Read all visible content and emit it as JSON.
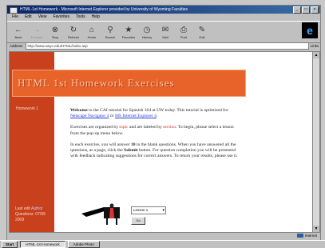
{
  "window": {
    "title": "HTML-1st Homework - Microsoft Internet Explorer provided by University of Wyoming Faculties",
    "min_label": "_",
    "max_label": "□",
    "close_label": "×"
  },
  "menu": [
    "File",
    "Edit",
    "View",
    "Favorites",
    "Tools",
    "Help"
  ],
  "toolbar": [
    {
      "label": "Back",
      "icon": "←",
      "icon_name": "back-arrow-icon",
      "enabled": true
    },
    {
      "label": "Forward",
      "icon": "→",
      "icon_name": "forward-arrow-icon",
      "enabled": false
    },
    {
      "label": "Stop",
      "icon": "⊗",
      "icon_name": "stop-icon",
      "enabled": true
    },
    {
      "label": "Refresh",
      "icon": "↻",
      "icon_name": "refresh-icon",
      "enabled": true
    },
    {
      "label": "Home",
      "icon": "⌂",
      "icon_name": "home-icon",
      "enabled": true
    },
    {
      "label": "Search",
      "icon": "⚲",
      "icon_name": "search-icon",
      "enabled": true
    },
    {
      "label": "Favorites",
      "icon": "★",
      "icon_name": "favorites-icon",
      "enabled": true
    },
    {
      "label": "History",
      "icon": "◷",
      "icon_name": "history-icon",
      "enabled": true
    },
    {
      "label": "Mail",
      "icon": "✉",
      "icon_name": "mail-icon",
      "enabled": true
    },
    {
      "label": "Print",
      "icon": "⎙",
      "icon_name": "print-icon",
      "enabled": true
    },
    {
      "label": "Edit",
      "icon": "✎",
      "icon_name": "edit-icon",
      "enabled": true
    }
  ],
  "address": {
    "label": "Address",
    "value": "http://www.uwyo.edu/HTML/index.asp",
    "go_label": "Links"
  },
  "page": {
    "banner": "HTML 1st Homework Exercises",
    "side_link": "Homework 1",
    "footer_line1": "Last edit",
    "footer_highlight": "Author",
    "footer_line2": "Questions: 07/99",
    "footer_line3": "2009",
    "intro_a": "Welcome",
    "intro_b": " to the CAI tutorial for Spanish 104 at UW today. This tutorial is optimized for ",
    "intro_link1": "Netscape Navigator 4",
    "intro_c": " or ",
    "intro_link2": "MS Internet Explorer 4",
    "intro_d": ".",
    "para2_a": "Exercises are organized by ",
    "para2_red1": "topic",
    "para2_b": " and are labeled by ",
    "para2_red2": "section",
    "para2_c": ". To begin, please select a lesson from the pop-up menu below.",
    "para3_a": "In each exercise, you will answer ",
    "para3_bold": "10",
    "para3_b": " in the blank questions. When you have answered all the questions, at a page, click the ",
    "para3_bold2": "Submit",
    "para3_c": " button. For question completion you will be presented with feedback indicating suggestions for correct answers. To return your results, please use it.",
    "select_value": "Lesson 1",
    "submit_label": "Go"
  },
  "status": {
    "left": "",
    "zone": "Internet"
  },
  "taskbar": {
    "start": "Start",
    "tasks": [
      "HTML-1st Homework",
      "Adobe Photo"
    ]
  }
}
